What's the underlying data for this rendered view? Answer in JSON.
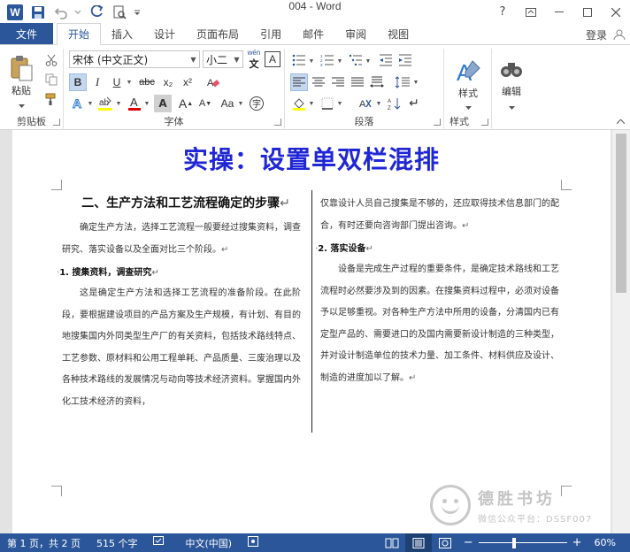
{
  "window": {
    "title": "004 - Word"
  },
  "tabs": {
    "file": "文件",
    "items": [
      "开始",
      "插入",
      "设计",
      "页面布局",
      "引用",
      "邮件",
      "审阅",
      "视图"
    ],
    "login": "登录"
  },
  "ribbon": {
    "clipboard": {
      "label": "剪贴板",
      "paste": "粘贴"
    },
    "font": {
      "label": "字体",
      "font_name": "宋体 (中文正文)",
      "font_size": "小二",
      "bold": "B",
      "italic": "I",
      "underline": "U",
      "strike": "abc",
      "subscript": "x₂",
      "superscript": "x²",
      "grow": "A",
      "shrink": "A",
      "case": "Aa",
      "pinyin": "wén",
      "charborder": "A"
    },
    "paragraph": {
      "label": "段落"
    },
    "styles": {
      "label": "样式",
      "button": "样式"
    },
    "editing": {
      "button": "编辑"
    }
  },
  "document": {
    "title": "实操：设置单双栏混排",
    "left": {
      "heading": "二、生产方法和工艺流程确定的步骤",
      "para1": "确定生产方法，选择工艺流程一般要经过搜集资料，调查研究、落实设备以及全面对比三个阶段。",
      "sub1": "1. 搜集资料，调查研究",
      "para2": "这是确定生产方法和选择工艺流程的准备阶段。在此阶段，要根据建设项目的产品方案及生产规模，有计划、有目的地搜集国内外同类型生产厂的有关资料，包括技术路线特点、工艺参数、原材料和公用工程单耗、产品质量、三废治理以及各种技术路线的发展情况与动向等技术经济资料。掌握国内外化工技术经济的资料，"
    },
    "right": {
      "para0": "仅靠设计人员自己搜集是不够的，还应取得技术信息部门的配合，有时还要向咨询部门提出咨询。",
      "sub2": "2. 落实设备",
      "para3": "设备是完成生产过程的重要条件，是确定技术路线和工艺流程时必然要涉及到的因素。在搜集资料过程中，必须对设备予以足够重视。对各种生产方法中所用的设备，分清国内已有定型产品的、需要进口的及国内需要新设计制造的三种类型，并对设计制造单位的技术力量、加工条件、材料供应及设计、制造的进度加以了解。"
    }
  },
  "status": {
    "page": "第 1 页，共 2 页",
    "words": "515 个字",
    "lang": "中文(中国)",
    "zoom": "60%"
  },
  "watermark": {
    "name": "德胜书坊",
    "sub": "微信公众平台：DSSF007"
  },
  "colors": {
    "brand": "#2b579a",
    "title_blue": "#1f26d4"
  }
}
